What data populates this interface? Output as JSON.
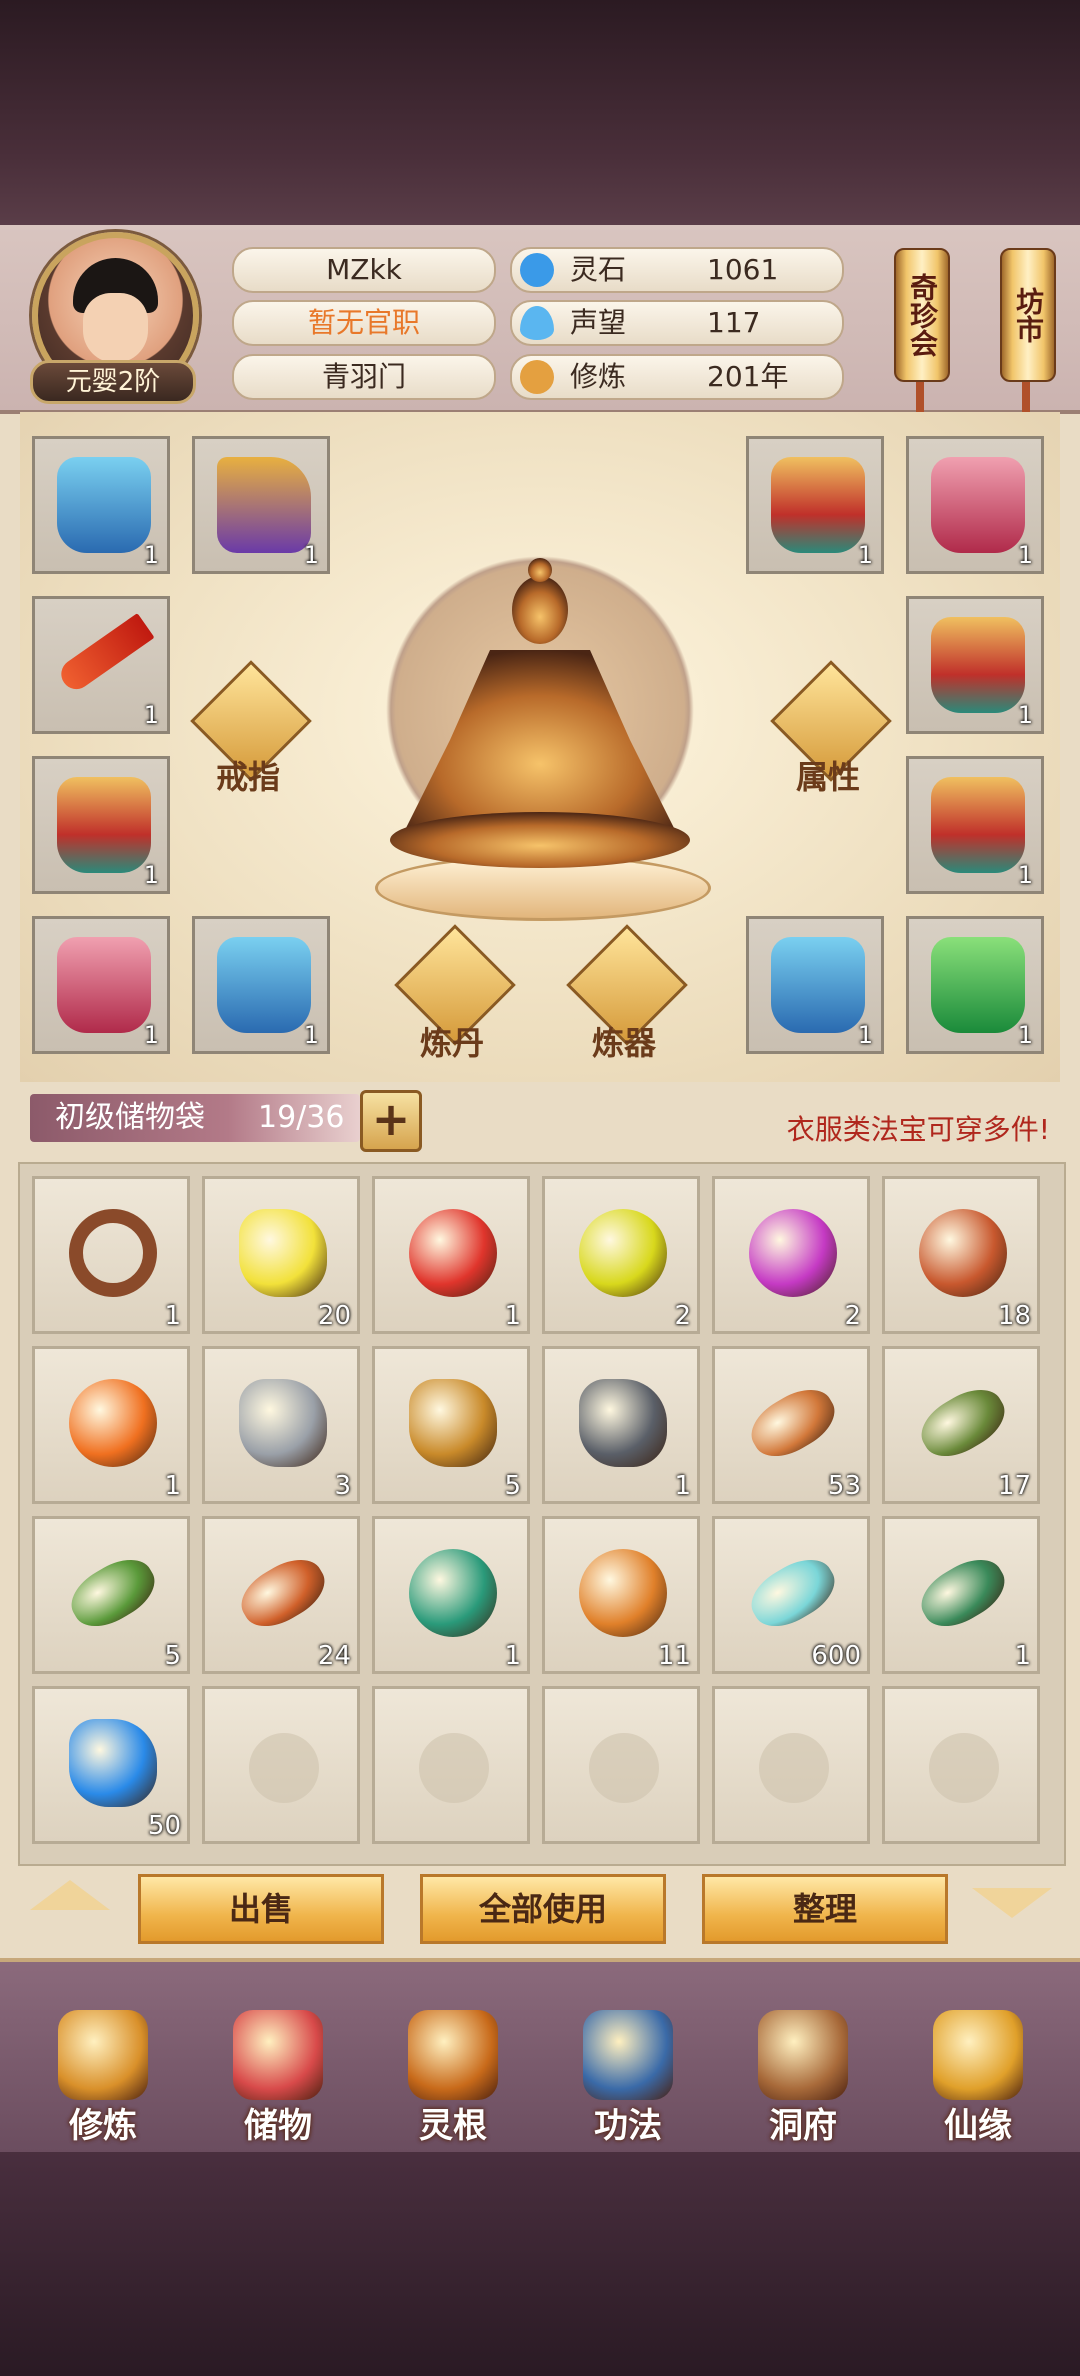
{
  "player": {
    "name": "MZkk",
    "official_title": "暂无官职",
    "sect": "青羽门",
    "realm": "元婴2阶"
  },
  "resources": [
    {
      "label": "灵石",
      "value": "1061",
      "icon": "spirit-stone-icon"
    },
    {
      "label": "声望",
      "value": "117",
      "icon": "reputation-icon"
    },
    {
      "label": "修炼",
      "value": "201年",
      "icon": "meditation-icon"
    }
  ],
  "side_buttons": {
    "treasure_fair": "奇珍会",
    "market": "坊市"
  },
  "equipment": {
    "ring_label": "戒指",
    "attributes_label": "属性",
    "alchemy_label": "炼丹",
    "forge_label": "炼器",
    "left_slots": [
      {
        "icon": "blue-armor-icon",
        "count": "1"
      },
      {
        "icon": "boots-icon",
        "count": "1"
      },
      {
        "icon": "dagger-icon",
        "count": "1"
      },
      {
        "icon": "gold-armor-icon",
        "count": "1"
      },
      {
        "icon": "pink-armor-icon",
        "count": "1"
      },
      {
        "icon": "blue-armor-icon",
        "count": "1"
      }
    ],
    "right_slots": [
      {
        "icon": "gold-armor-icon",
        "count": "1"
      },
      {
        "icon": "pink-armor-icon",
        "count": "1"
      },
      {
        "icon": "gold-armor-icon",
        "count": "1"
      },
      {
        "icon": "gold-armor-icon",
        "count": "1"
      },
      {
        "icon": "blue-armor-icon",
        "count": "1"
      },
      {
        "icon": "green-armor-icon",
        "count": "1"
      }
    ]
  },
  "bag": {
    "name": "初级储物袋",
    "capacity": "19/36",
    "add_button": "+",
    "hint": "衣服类法宝可穿多件!",
    "items": [
      {
        "icon": "ring-icon",
        "count": "1",
        "color": "#8a4a2a"
      },
      {
        "icon": "yellow-stone-icon",
        "count": "20",
        "color": "#f2e13a"
      },
      {
        "icon": "red-orb-icon",
        "count": "1",
        "color": "#e0352c"
      },
      {
        "icon": "yellow-orb-icon",
        "count": "2",
        "color": "#d8d81c"
      },
      {
        "icon": "purple-orb-icon",
        "count": "2",
        "color": "#c53ac4"
      },
      {
        "icon": "bronze-orb-icon",
        "count": "18",
        "color": "#c8582e"
      },
      {
        "icon": "orange-orb-icon",
        "count": "1",
        "color": "#f07020"
      },
      {
        "icon": "silver-ore-icon",
        "count": "3",
        "color": "#9aa0a8"
      },
      {
        "icon": "gold-ore-icon",
        "count": "5",
        "color": "#c98a2a"
      },
      {
        "icon": "iron-ore-icon",
        "count": "1",
        "color": "#5a5f68"
      },
      {
        "icon": "ginseng-icon",
        "count": "53",
        "color": "#d2783a"
      },
      {
        "icon": "herb-root-icon",
        "count": "17",
        "color": "#6a8a3a"
      },
      {
        "icon": "flower-herb-icon",
        "count": "5",
        "color": "#5a9a3a"
      },
      {
        "icon": "cordyceps-icon",
        "count": "24",
        "color": "#d0602a"
      },
      {
        "icon": "green-gourd-icon",
        "count": "1",
        "color": "#2a9a7a"
      },
      {
        "icon": "orange-gourd-icon",
        "count": "11",
        "color": "#e0802a"
      },
      {
        "icon": "crystal-sword-icon",
        "count": "600",
        "color": "#7ad6d8"
      },
      {
        "icon": "flying-sword-icon",
        "count": "1",
        "color": "#3a8a5a"
      },
      {
        "icon": "blue-crystal-icon",
        "count": "50",
        "color": "#2a8ae8"
      },
      {
        "icon": "empty-slot-icon",
        "count": ""
      },
      {
        "icon": "empty-slot-icon",
        "count": ""
      },
      {
        "icon": "empty-slot-icon",
        "count": ""
      },
      {
        "icon": "empty-slot-icon",
        "count": ""
      },
      {
        "icon": "empty-slot-icon",
        "count": ""
      }
    ]
  },
  "actions": {
    "sell": "出售",
    "use_all": "全部使用",
    "organize": "整理"
  },
  "nav": [
    {
      "label": "修炼",
      "icon": "cultivate-icon",
      "color": "#d9902a"
    },
    {
      "label": "储物",
      "icon": "storage-bag-icon",
      "color": "#d84a4a"
    },
    {
      "label": "灵根",
      "icon": "spirit-root-icon",
      "color": "#c86a1a"
    },
    {
      "label": "功法",
      "icon": "scripture-icon",
      "color": "#3a6aa8"
    },
    {
      "label": "洞府",
      "icon": "cave-abode-icon",
      "color": "#a86a3a"
    },
    {
      "label": "仙缘",
      "icon": "fortune-gourd-icon",
      "color": "#e0a02a"
    }
  ]
}
